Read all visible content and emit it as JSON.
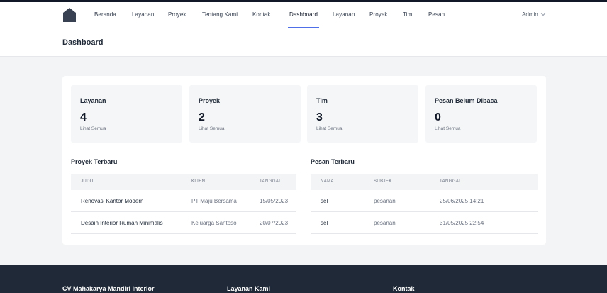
{
  "nav": {
    "links": [
      "Beranda",
      "Layanan",
      "Proyek",
      "Tentang Kami",
      "Kontak",
      "Dashboard",
      "Layanan",
      "Proyek",
      "Tim",
      "Pesan"
    ],
    "active": "Dashboard",
    "admin_label": "Admin"
  },
  "header": {
    "title": "Dashboard"
  },
  "stats": [
    {
      "label": "Layanan",
      "value": "4",
      "link": "Lihat Semua"
    },
    {
      "label": "Proyek",
      "value": "2",
      "link": "Lihat Semua"
    },
    {
      "label": "Tim",
      "value": "3",
      "link": "Lihat Semua"
    },
    {
      "label": "Pesan Belum Dibaca",
      "value": "0",
      "link": "Lihat Semua"
    }
  ],
  "recent_projects": {
    "title": "Proyek Terbaru",
    "columns": [
      "JUDUL",
      "KLIEN",
      "TANGGAL"
    ],
    "rows": [
      [
        "Renovasi Kantor Modern",
        "PT Maju Bersama",
        "15/05/2023"
      ],
      [
        "Desain Interior Rumah Minimalis",
        "Keluarga Santoso",
        "20/07/2023"
      ]
    ]
  },
  "recent_messages": {
    "title": "Pesan Terbaru",
    "columns": [
      "NAMA",
      "SUBJEK",
      "TANGGAL"
    ],
    "rows": [
      [
        "sel",
        "pesanan",
        "25/06/2025 14:21"
      ],
      [
        "sel",
        "pesanan",
        "31/05/2025 22:54"
      ]
    ]
  },
  "footer": {
    "columns": [
      "CV Mahakarya Mandiri Interior",
      "Layanan Kami",
      "Kontak"
    ]
  },
  "colors": {
    "accent": "#4f6fe8",
    "footer_bg": "#1f2937",
    "page_bg": "#f3f4f6"
  }
}
